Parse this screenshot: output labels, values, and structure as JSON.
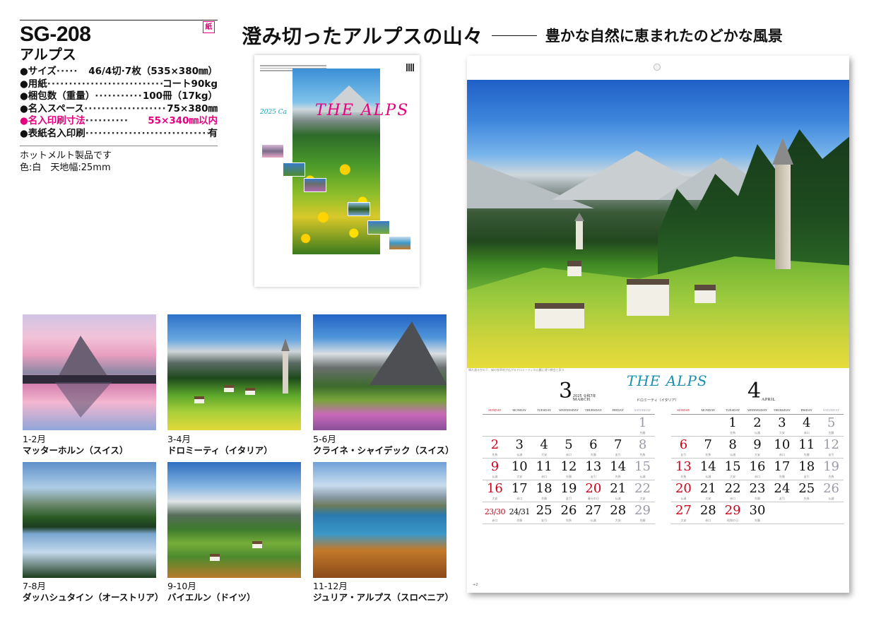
{
  "product": {
    "code": "SG-208",
    "name": "アルプス",
    "specs": [
      {
        "label": "●サイズ",
        "dots": "·····",
        "value": "46/4切·7枚（535×380㎜）",
        "highlight": false
      },
      {
        "label": "●用紙",
        "dots": "·······························",
        "value": "コート90kg",
        "highlight": false
      },
      {
        "label": "●梱包数（重量）",
        "dots": "·····················",
        "value": "100冊（17kg）",
        "highlight": false
      },
      {
        "label": "●名入スペース",
        "dots": "····················",
        "value": "75×380㎜",
        "highlight": false
      },
      {
        "label": "●名入印刷寸法",
        "dots": "··········",
        "value": "55×340㎜以内",
        "highlight": true
      },
      {
        "label": "●表紙名入印刷",
        "dots": "·······························",
        "value": "有",
        "highlight": false
      }
    ],
    "notes": [
      "ホットメルト製品です",
      "色:白　天地幅:25mm"
    ],
    "paper_badge": "紙",
    "colors": {
      "accent": "#e4007f",
      "sunday": "#d0021b",
      "saturday": "#9a9aa8"
    }
  },
  "headline": {
    "main": "澄み切ったアルプスの山々",
    "sub": "豊かな自然に恵まれたのどかな風景"
  },
  "preview": {
    "year_label": "2025 Ca",
    "title": "THE ALPS"
  },
  "thumbnails": [
    {
      "months": "1-2月",
      "place": "マッターホルン（スイス）"
    },
    {
      "months": "3-4月",
      "place": "ドロミーティ（イタリア）"
    },
    {
      "months": "5-6月",
      "place": "クライネ・シャイデック（スイス）"
    },
    {
      "months": "7-8月",
      "place": "ダッハシュタイン（オーストリア）"
    },
    {
      "months": "9-10月",
      "place": "バイエルン（ドイツ）"
    },
    {
      "months": "11-12月",
      "place": "ジュリア・アルプス（スロベニア）"
    }
  ],
  "calendar": {
    "photo_caption": "晴れ渡る空の下、緑の牧草地が広がるドロミーティの山麓に建つ教会と家々",
    "logo": "THE ALPS",
    "place": "ドロミーティ（イタリア）",
    "dow": [
      "SUNDAY",
      "MONDAY",
      "TUESDAY",
      "WEDNESDAY",
      "THURSDAY",
      "FRIDAY",
      "SATURDAY"
    ],
    "page_no": "+2",
    "months": [
      {
        "num": "3",
        "name": "MARCH",
        "year": "2025 令和7年",
        "weeks": [
          [
            {
              "d": ""
            },
            {
              "d": ""
            },
            {
              "d": ""
            },
            {
              "d": ""
            },
            {
              "d": ""
            },
            {
              "d": ""
            },
            {
              "d": "1",
              "t": "sat",
              "r": "先勝"
            }
          ],
          [
            {
              "d": "2",
              "t": "sun",
              "r": "先負"
            },
            {
              "d": "3",
              "r": "仏滅"
            },
            {
              "d": "4",
              "r": "大安"
            },
            {
              "d": "5",
              "r": "赤口"
            },
            {
              "d": "6",
              "r": "先勝"
            },
            {
              "d": "7",
              "r": "友引"
            },
            {
              "d": "8",
              "t": "sat",
              "r": "先負"
            }
          ],
          [
            {
              "d": "9",
              "t": "sun",
              "r": "仏滅"
            },
            {
              "d": "10",
              "r": "大安"
            },
            {
              "d": "11",
              "r": "赤口"
            },
            {
              "d": "12",
              "r": "先勝"
            },
            {
              "d": "13",
              "r": "友引"
            },
            {
              "d": "14",
              "r": "先負"
            },
            {
              "d": "15",
              "t": "sat",
              "r": "仏滅"
            }
          ],
          [
            {
              "d": "16",
              "t": "sun",
              "r": "大安"
            },
            {
              "d": "17",
              "r": "赤口"
            },
            {
              "d": "18",
              "r": "先勝"
            },
            {
              "d": "19",
              "r": "友引"
            },
            {
              "d": "20",
              "t": "hol",
              "r": "春分の日"
            },
            {
              "d": "21",
              "r": "仏滅"
            },
            {
              "d": "22",
              "t": "sat",
              "r": "大安"
            }
          ],
          [
            {
              "d": "23/30",
              "t": "sun",
              "r": "赤口"
            },
            {
              "d": "24/31",
              "r": "先勝"
            },
            {
              "d": "25",
              "r": "友引"
            },
            {
              "d": "26",
              "r": "先負"
            },
            {
              "d": "27",
              "r": "仏滅"
            },
            {
              "d": "28",
              "r": "大安"
            },
            {
              "d": "29",
              "t": "sat",
              "r": "先勝"
            }
          ]
        ]
      },
      {
        "num": "4",
        "name": "APRIL",
        "year": "",
        "weeks": [
          [
            {
              "d": ""
            },
            {
              "d": ""
            },
            {
              "d": "1",
              "r": "先負"
            },
            {
              "d": "2",
              "r": "仏滅"
            },
            {
              "d": "3",
              "r": "大安"
            },
            {
              "d": "4",
              "r": "赤口"
            },
            {
              "d": "5",
              "t": "sat",
              "r": "先勝"
            }
          ],
          [
            {
              "d": "6",
              "t": "sun",
              "r": "友引"
            },
            {
              "d": "7",
              "r": "先負"
            },
            {
              "d": "8",
              "r": "仏滅"
            },
            {
              "d": "9",
              "r": "大安"
            },
            {
              "d": "10",
              "r": "赤口"
            },
            {
              "d": "11",
              "r": "先勝"
            },
            {
              "d": "12",
              "t": "sat",
              "r": "友引"
            }
          ],
          [
            {
              "d": "13",
              "t": "sun",
              "r": "先負"
            },
            {
              "d": "14",
              "r": "仏滅"
            },
            {
              "d": "15",
              "r": "大安"
            },
            {
              "d": "16",
              "r": "赤口"
            },
            {
              "d": "17",
              "r": "先勝"
            },
            {
              "d": "18",
              "r": "友引"
            },
            {
              "d": "19",
              "t": "sat",
              "r": "先負"
            }
          ],
          [
            {
              "d": "20",
              "t": "sun",
              "r": "仏滅"
            },
            {
              "d": "21",
              "r": "大安"
            },
            {
              "d": "22",
              "r": "赤口"
            },
            {
              "d": "23",
              "r": "先勝"
            },
            {
              "d": "24",
              "r": "友引"
            },
            {
              "d": "25",
              "r": "先負"
            },
            {
              "d": "26",
              "t": "sat",
              "r": "仏滅"
            }
          ],
          [
            {
              "d": "27",
              "t": "sun",
              "r": "大安"
            },
            {
              "d": "28",
              "r": "赤口"
            },
            {
              "d": "29",
              "t": "hol",
              "r": "昭和の日"
            },
            {
              "d": "30",
              "r": "先勝"
            },
            {
              "d": ""
            },
            {
              "d": ""
            },
            {
              "d": ""
            }
          ]
        ]
      }
    ]
  }
}
